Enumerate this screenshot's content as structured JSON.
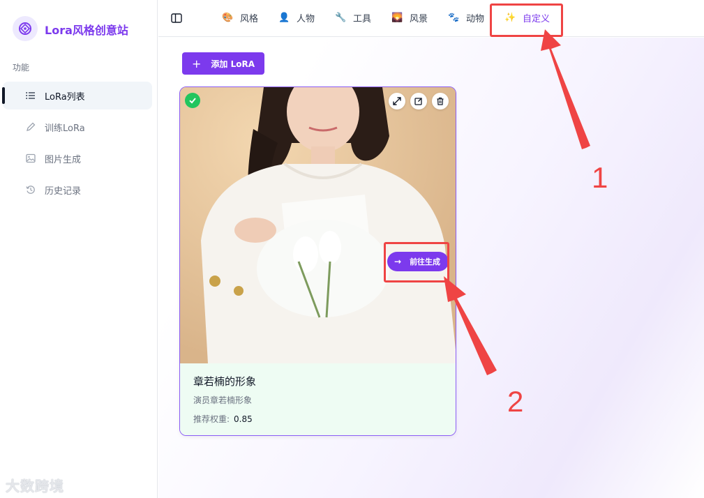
{
  "app": {
    "title": "Lora风格创意站",
    "brand_color": "#7c3aed"
  },
  "sidebar": {
    "section_label": "功能",
    "items": [
      {
        "label": "LoRa列表",
        "icon": "list-icon",
        "active": true
      },
      {
        "label": "训练LoRa",
        "icon": "pencil-icon",
        "active": false
      },
      {
        "label": "图片生成",
        "icon": "image-icon",
        "active": false
      },
      {
        "label": "历史记录",
        "icon": "history-icon",
        "active": false
      }
    ]
  },
  "topbar": {
    "toggle_icon": "sidebar-toggle-icon",
    "categories": [
      {
        "label": "风格",
        "icon": "palette-icon",
        "glyph": "🎨"
      },
      {
        "label": "人物",
        "icon": "person-icon",
        "glyph": "👤"
      },
      {
        "label": "工具",
        "icon": "wrench-icon",
        "glyph": "🔧"
      },
      {
        "label": "风景",
        "icon": "landscape-icon",
        "glyph": "🌄"
      },
      {
        "label": "动物",
        "icon": "paw-icon",
        "glyph": "🐾"
      },
      {
        "label": "自定义",
        "icon": "sparkles-icon",
        "glyph": "✨"
      }
    ]
  },
  "main": {
    "add_button": {
      "plus": "+",
      "label": "添加 LoRA"
    },
    "card": {
      "title": "章若楠的形象",
      "description": "演员章若楠形象",
      "weight_label": "推荐权重:",
      "weight_value": "0.85",
      "generate_label": "前往生成",
      "selected": true
    }
  },
  "annotations": {
    "label_1": "1",
    "label_2": "2",
    "color": "#ef4444"
  },
  "watermark": "大数跨境"
}
